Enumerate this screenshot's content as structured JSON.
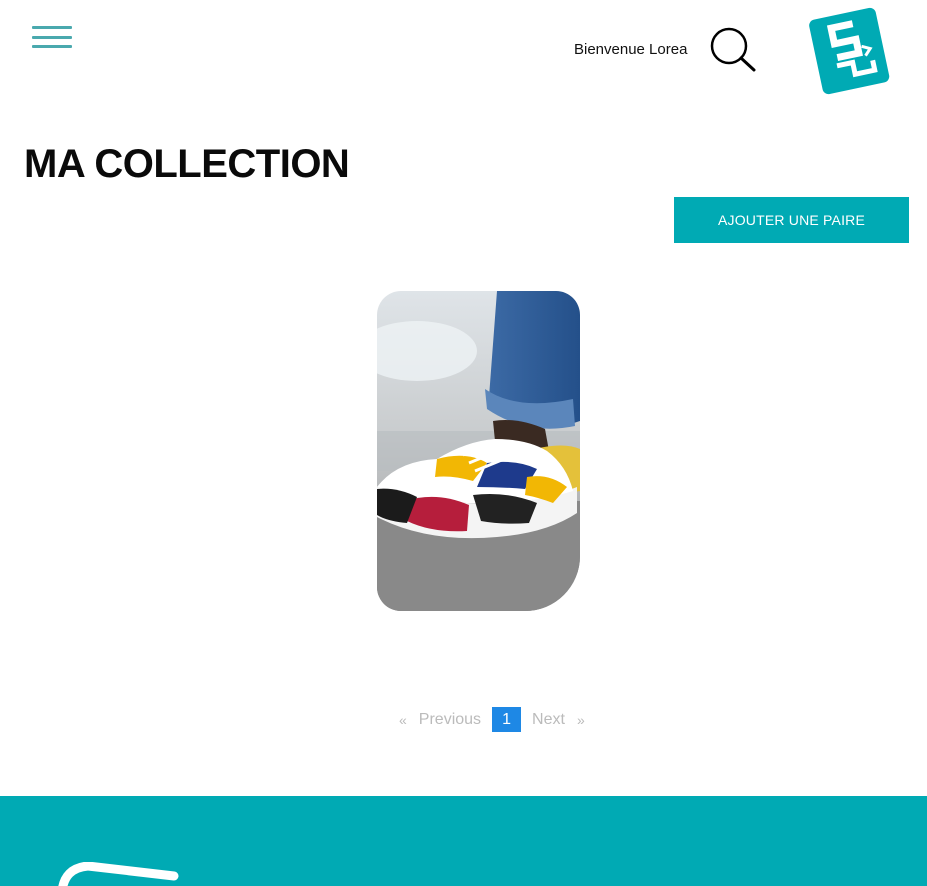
{
  "header": {
    "welcome_text": "Bienvenue Lorea",
    "menu_icon": "hamburger-menu-icon",
    "search_icon": "search-icon",
    "logo_icon": "brand-logo-icon"
  },
  "main": {
    "title": "MA COLLECTION",
    "add_button_label": "AJOUTER UNE PAIRE",
    "sneakers": [
      {
        "image": "sneaker-photo"
      }
    ]
  },
  "pagination": {
    "first_arrow": "«",
    "previous_label": "Previous",
    "current_page": "1",
    "next_label": "Next",
    "last_arrow": "»"
  },
  "colors": {
    "accent": "#00aab4",
    "menu_lines": "#4aa9ae",
    "active_page": "#1e88e5",
    "pagination_text": "#bbbbbb"
  }
}
